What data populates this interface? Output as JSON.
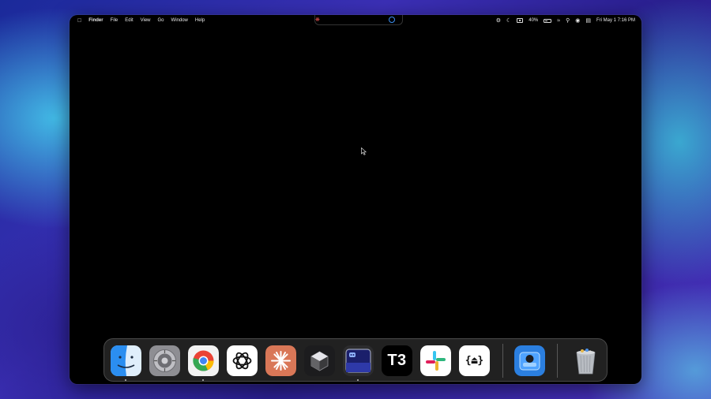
{
  "menubar": {
    "app_name": "Finder",
    "menus": [
      "File",
      "Edit",
      "View",
      "Go",
      "Window",
      "Help"
    ],
    "battery_percent": "40%",
    "clock": "Fri May 1  7:16 PM",
    "status_icons": [
      "gear-icon",
      "moon-icon",
      "display-icon",
      "battery-icon",
      "wifi-icon",
      "search-icon",
      "siri-icon",
      "control-center-icon"
    ]
  },
  "dock": {
    "apps": [
      "Finder",
      "System Settings",
      "Google Chrome",
      "ChatGPT",
      "Claude",
      "Cursor",
      "Screen App",
      "T3",
      "Slack",
      "Code App",
      "Preview",
      "Trash"
    ],
    "t3_label": "T3",
    "code_label": "{⏏}"
  },
  "colors": {
    "screen": "#000000",
    "chrome_red": "#ea4335",
    "chrome_yellow": "#fbbc05",
    "chrome_green": "#34a853",
    "chrome_blue": "#4285f4",
    "claude": "#d97757",
    "finder_blue": "#2b8ef0"
  }
}
